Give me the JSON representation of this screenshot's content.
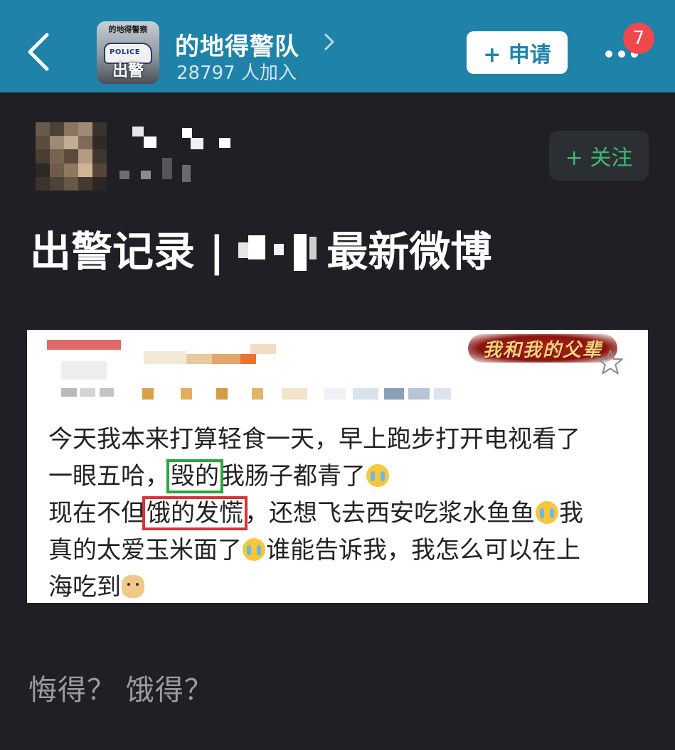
{
  "header": {
    "back_label": "<",
    "group_avatar_top": "的地得警察",
    "group_avatar_car_text": "POLICE",
    "group_avatar_bottom": "出警",
    "group_name": "的地得警队",
    "member_count": "28797 人加入",
    "apply_button": "+ 申请",
    "notification_count": "7"
  },
  "post": {
    "follow_button": "+ 关注",
    "title_prefix": "出警记录 |",
    "title_suffix": "最新微博"
  },
  "screenshot": {
    "banner_text": "我和我的父辈",
    "body_line1_a": "今天我本来打算轻食一天，早上跑步打开电视看了",
    "body_line2_a": "一眼五哈，",
    "body_line2_boxed": "毁的",
    "body_line2_b": "我肠子都青了",
    "body_line3_a": "现在不但",
    "body_line3_boxed": "饿的发慌",
    "body_line3_b": "，还想飞去西安吃浆水鱼鱼",
    "body_line3_c": "我",
    "body_line4_a": "真的太爱玉米面了",
    "body_line4_b": "谁能告诉我，我怎么可以在上",
    "body_line5_a": "海吃到"
  },
  "caption": "悔得？  饿得？",
  "colors": {
    "header_bg": "#1f82a8",
    "page_bg": "#1f1f25",
    "follow_green": "#3dbb6f",
    "badge_red": "#f0484d",
    "highlight_green": "#2aa43c",
    "highlight_red": "#d8333a"
  }
}
